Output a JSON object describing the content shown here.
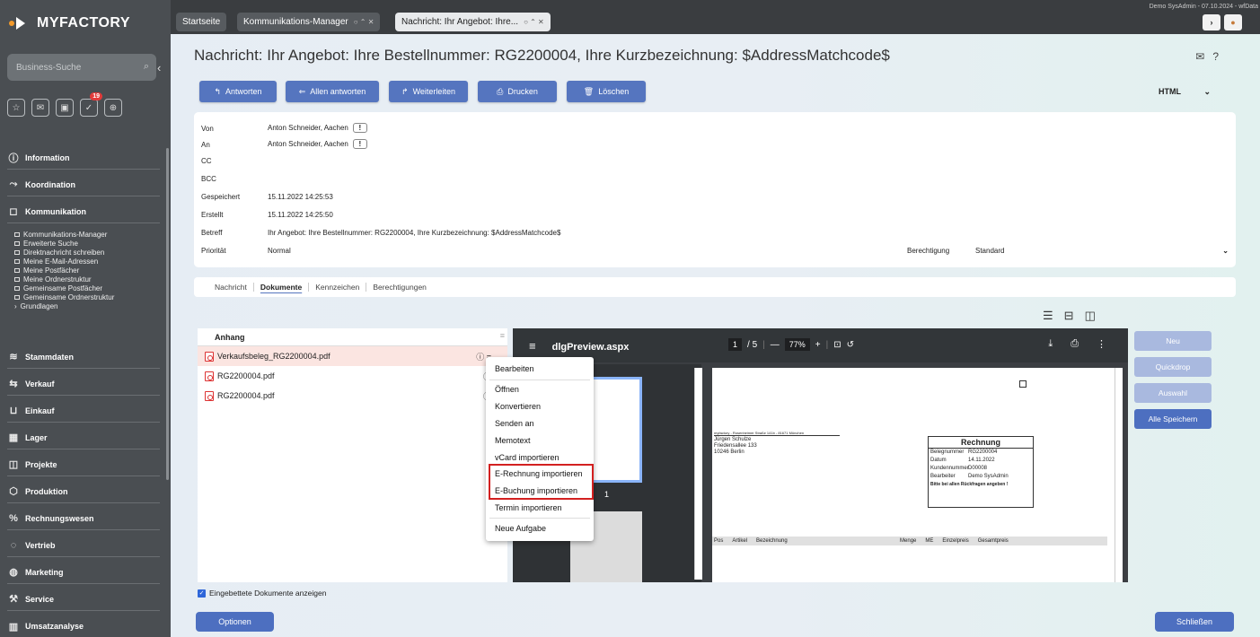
{
  "app": {
    "logo_text": "MYFACTORY",
    "user_line": "Demo SysAdmin - 07.10.2024 - wfData"
  },
  "sidebar": {
    "search_placeholder": "Business-Suche",
    "quick_badge": "19",
    "sections_top": [
      {
        "label": "Information",
        "icon": "info-icon",
        "glyph": "ⓘ"
      },
      {
        "label": "Koordination",
        "icon": "coordination-icon",
        "glyph": "⤳"
      },
      {
        "label": "Kommunikation",
        "icon": "chat-icon",
        "glyph": "🗨"
      }
    ],
    "subitems": [
      "Kommunikations-Manager",
      "Erweiterte Suche",
      "Direktnachricht schreiben",
      "Meine E-Mail-Adressen",
      "Meine Postfächer",
      "Meine Ordnerstruktur",
      "Gemeinsame Postfächer",
      "Gemeinsame Ordnerstruktur"
    ],
    "subgroup": "Grundlagen",
    "sections_bottom": [
      {
        "label": "Stammdaten",
        "icon": "database-icon",
        "glyph": "≋"
      },
      {
        "label": "Verkauf",
        "icon": "sales-icon",
        "glyph": "⇆"
      },
      {
        "label": "Einkauf",
        "icon": "cart-icon",
        "glyph": "🛒"
      },
      {
        "label": "Lager",
        "icon": "warehouse-icon",
        "glyph": "▦"
      },
      {
        "label": "Projekte",
        "icon": "project-icon",
        "glyph": "◫"
      },
      {
        "label": "Produktion",
        "icon": "production-icon",
        "glyph": "⬡"
      },
      {
        "label": "Rechnungswesen",
        "icon": "accounting-icon",
        "glyph": "%"
      },
      {
        "label": "Vertrieb",
        "icon": "distribution-icon",
        "glyph": "◌"
      },
      {
        "label": "Marketing",
        "icon": "marketing-icon",
        "glyph": "◍"
      },
      {
        "label": "Service",
        "icon": "service-icon",
        "glyph": "⚒"
      },
      {
        "label": "Umsatzanalyse",
        "icon": "analysis-icon",
        "glyph": "▥"
      }
    ]
  },
  "tabs": [
    "Startseite",
    "Kommunikations-Manager",
    "Nachricht: Ihr Angebot: Ihre..."
  ],
  "page": {
    "title": "Nachricht: Ihr Angebot: Ihre Bestellnummer: RG2200004, Ihre Kurzbezeichnung: $AddressMatchcode$"
  },
  "actions": {
    "reply": "Antworten",
    "reply_all": "Allen antworten",
    "forward": "Weiterleiten",
    "print": "Drucken",
    "delete": "Löschen",
    "format": "HTML"
  },
  "header_fields": {
    "von_label": "Von",
    "von_value": "Anton Schneider, Aachen",
    "an_label": "An",
    "an_value": "Anton Schneider, Aachen",
    "cc_label": "CC",
    "bcc_label": "BCC",
    "gespeichert_label": "Gespeichert",
    "gespeichert_value": "15.11.2022 14:25:53",
    "erstellt_label": "Erstellt",
    "erstellt_value": "15.11.2022 14:25:50",
    "betreff_label": "Betreff",
    "betreff_value": "Ihr Angebot: Ihre Bestellnummer: RG2200004, Ihre Kurzbezeichnung: $AddressMatchcode$",
    "prioritaet_label": "Priorität",
    "prioritaet_value": "Normal",
    "berechtigung_label": "Berechtigung",
    "berechtigung_value": "Standard",
    "excl": "!"
  },
  "subtabs": [
    "Nachricht",
    "Dokumente",
    "Kennzeichen",
    "Berechtigungen"
  ],
  "attachments": {
    "header": "Anhang",
    "files": [
      "Verkaufsbeleg_RG2200004.pdf",
      "RG2200004.pdf",
      "RG2200004.pdf"
    ]
  },
  "context_menu": [
    "Bearbeiten",
    "Öffnen",
    "Konvertieren",
    "Senden an",
    "Memotext",
    "vCard importieren",
    "E-Rechnung importieren",
    "E-Buchung importieren",
    "Termin importieren",
    "Neue Aufgabe"
  ],
  "preview": {
    "title": "dlgPreview.aspx",
    "page_current": "1",
    "page_total": "/ 5",
    "zoom": "77%",
    "thumb_number": "1",
    "doc": {
      "sender_line": "myfactory - Rosenheimer Straße 141b - 81671 München",
      "addr1": "Jürgen Schulze",
      "addr2": "Friedensallee 133",
      "addr3": "10246 Berlin",
      "box_title": "Rechnung",
      "rows": [
        [
          "Belegnummer",
          "RG2200004"
        ],
        [
          "Datum",
          "14.11.2022"
        ],
        [
          "Kundennummer",
          "D00008"
        ],
        [
          "Bearbeiter",
          "Demo SysAdmin"
        ]
      ],
      "note": "Bitte bei allen Rückfragen angeben !",
      "cols": [
        "Pos",
        "Artikel",
        "Bezeichnung",
        "Menge",
        "ME",
        "Einzelpreis",
        "Gesamtpreis"
      ]
    }
  },
  "side_buttons": {
    "neu": "Neu",
    "quickdrop": "Quickdrop",
    "auswahl": "Auswahl",
    "alle_speichern": "Alle Speichern"
  },
  "footer": {
    "checkbox_label": "Eingebettete Dokumente anzeigen",
    "options": "Optionen",
    "close": "Schließen"
  }
}
